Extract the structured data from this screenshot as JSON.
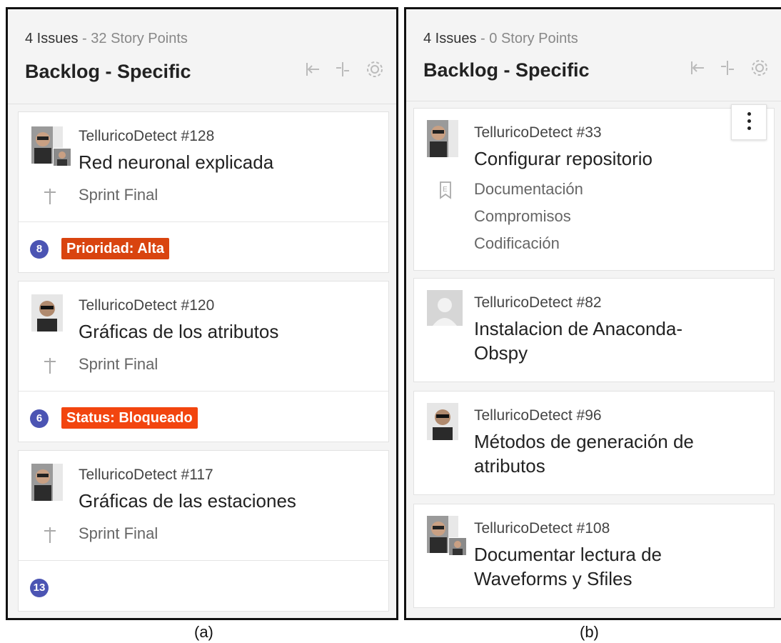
{
  "panel_a": {
    "summary_issues": "4 Issues",
    "summary_sep": " - ",
    "summary_points": "32 Story Points",
    "title": "Backlog - Specific",
    "cards": [
      {
        "id": "TelluricoDetect #128",
        "title": "Red neuronal explicada",
        "sprint": "Sprint Final",
        "points": "8",
        "tag": "Prioridad: Alta",
        "tag_color": "#d9440f"
      },
      {
        "id": "TelluricoDetect #120",
        "title": "Gráficas de los atributos",
        "sprint": "Sprint Final",
        "points": "6",
        "tag": "Status: Bloqueado",
        "tag_color": "#f2450f"
      },
      {
        "id": "TelluricoDetect #117",
        "title": "Gráficas de las estaciones",
        "sprint": "Sprint Final",
        "points": "13"
      }
    ],
    "caption": "(a)"
  },
  "panel_b": {
    "summary_issues": "4 Issues",
    "summary_sep": " - ",
    "summary_points": "0 Story Points",
    "title": "Backlog - Specific",
    "cards": [
      {
        "id": "TelluricoDetect #33",
        "title": "Configurar repositorio",
        "labels": [
          "Documentación",
          "Compromisos",
          "Codificación"
        ]
      },
      {
        "id": "TelluricoDetect #82",
        "title_line1": "Instalacion de Anaconda-",
        "title_line2": "Obspy"
      },
      {
        "id": "TelluricoDetect #96",
        "title_line1": "Métodos de generación de",
        "title_line2": "atributos"
      },
      {
        "id": "TelluricoDetect #108",
        "title_line1": "Documentar lectura de",
        "title_line2": "Waveforms y Sfiles"
      }
    ],
    "caption": "(b)"
  },
  "icons": [
    "collapse-left-icon",
    "collapse-columns-icon",
    "gear-icon",
    "milestone-icon",
    "label-icon",
    "kebab-menu-icon",
    "avatar-placeholder-icon"
  ],
  "colors": {
    "points_badge": "#4b54b3",
    "panel_bg": "#f4f4f4",
    "card_border": "#e2e2e2"
  }
}
